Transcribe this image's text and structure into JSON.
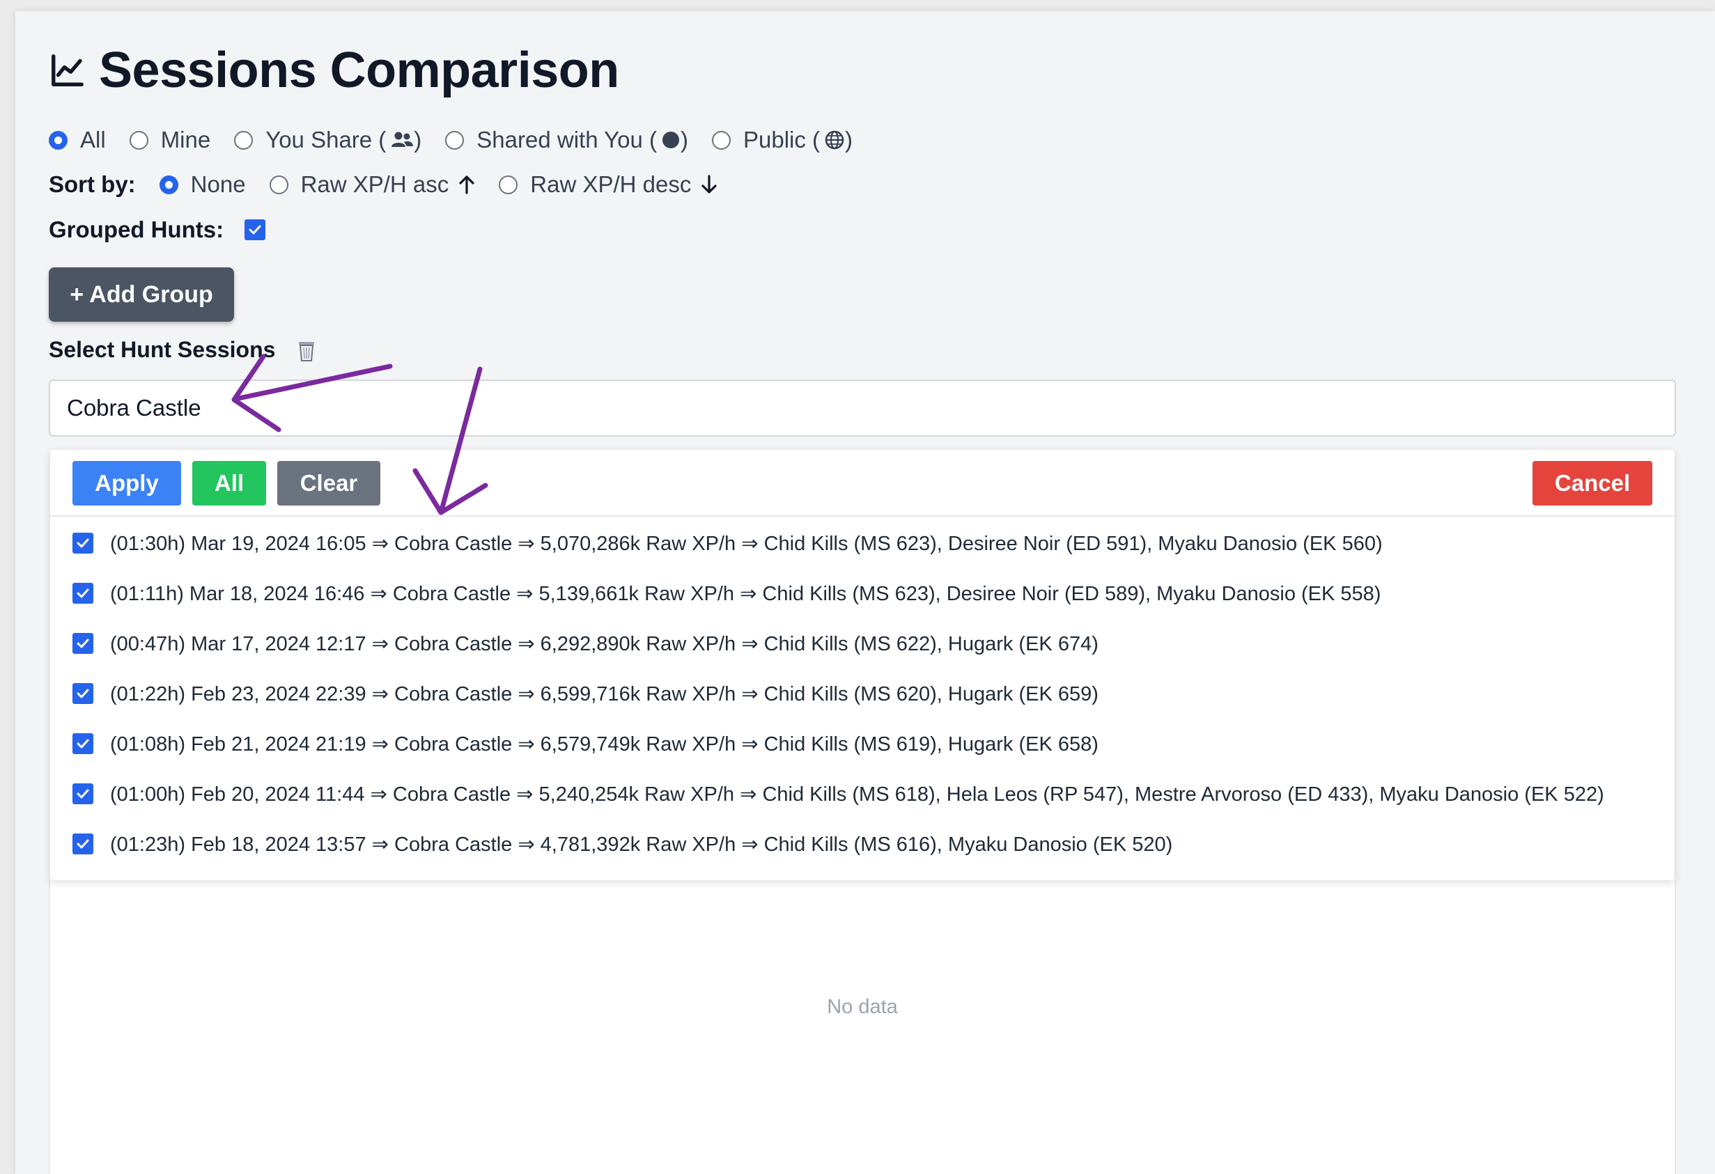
{
  "page": {
    "title": "Sessions Comparison",
    "title_icon": "line-chart-icon"
  },
  "filter": {
    "options": [
      {
        "label": "All",
        "selected": true
      },
      {
        "label": "Mine",
        "selected": false
      },
      {
        "label": "You Share (",
        "suffix": ")",
        "icon": "users-icon",
        "selected": false
      },
      {
        "label": "Shared with You (",
        "suffix": ")",
        "icon": "filled-circle-icon",
        "selected": false
      },
      {
        "label": "Public (",
        "suffix": ")",
        "icon": "globe-icon",
        "selected": false
      }
    ]
  },
  "sort": {
    "label": "Sort by:",
    "options": [
      {
        "label": "None",
        "selected": true
      },
      {
        "label": "Raw XP/H asc",
        "icon": "arrow-up-icon",
        "selected": false
      },
      {
        "label": "Raw XP/H desc",
        "icon": "arrow-down-icon",
        "selected": false
      }
    ]
  },
  "grouped": {
    "label": "Grouped Hunts:",
    "checked": true
  },
  "add_group": {
    "label": "+ Add Group"
  },
  "select": {
    "label": "Select Hunt Sessions",
    "trash_icon": "trash-icon",
    "search_value": "Cobra Castle"
  },
  "dropdown": {
    "buttons": {
      "apply": "Apply",
      "all": "All",
      "clear": "Clear",
      "cancel": "Cancel"
    },
    "sessions": [
      {
        "checked": true,
        "text": "(01:30h) Mar 19, 2024 16:05 ⇒ Cobra Castle ⇒ 5,070,286k Raw XP/h ⇒ Chid Kills (MS 623), Desiree Noir (ED 591), Myaku Danosio (EK 560)"
      },
      {
        "checked": true,
        "text": "(01:11h) Mar 18, 2024 16:46 ⇒ Cobra Castle ⇒ 5,139,661k Raw XP/h ⇒ Chid Kills (MS 623), Desiree Noir (ED 589), Myaku Danosio (EK 558)"
      },
      {
        "checked": true,
        "text": "(00:47h) Mar 17, 2024 12:17 ⇒ Cobra Castle ⇒ 6,292,890k Raw XP/h ⇒ Chid Kills (MS 622), Hugark (EK 674)"
      },
      {
        "checked": true,
        "text": "(01:22h) Feb 23, 2024 22:39 ⇒ Cobra Castle ⇒ 6,599,716k Raw XP/h ⇒ Chid Kills (MS 620), Hugark (EK 659)"
      },
      {
        "checked": true,
        "text": "(01:08h) Feb 21, 2024 21:19 ⇒ Cobra Castle ⇒ 6,579,749k Raw XP/h ⇒ Chid Kills (MS 619), Hugark (EK 658)"
      },
      {
        "checked": true,
        "text": "(01:00h) Feb 20, 2024 11:44 ⇒ Cobra Castle ⇒ 5,240,254k Raw XP/h ⇒ Chid Kills (MS 618), Hela Leos (RP 547), Mestre Arvoroso (ED 433), Myaku Danosio (EK 522)"
      },
      {
        "checked": true,
        "text": "(01:23h) Feb 18, 2024 13:57 ⇒ Cobra Castle ⇒ 4,781,392k Raw XP/h ⇒ Chid Kills (MS 616), Myaku Danosio (EK 520)"
      }
    ]
  },
  "chart": {
    "empty_text": "No data"
  },
  "annotations": {
    "color": "#7b2a9e"
  },
  "colors": {
    "primary": "#3b82f6",
    "success": "#22c55e",
    "neutral": "#6b7280",
    "danger": "#e5443d",
    "dark_button": "#4b5563"
  }
}
